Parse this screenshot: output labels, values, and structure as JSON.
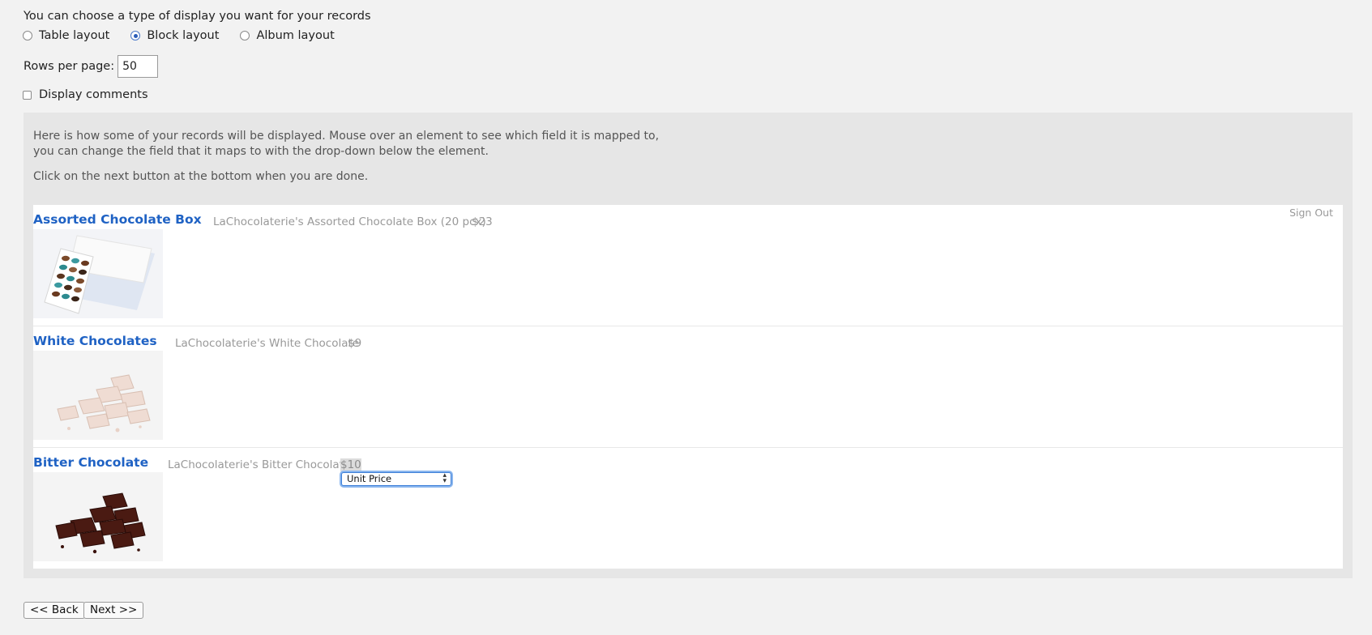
{
  "intro_text": "You can choose a type of display you want for your records",
  "layout_options": [
    {
      "label": "Table layout",
      "checked": false
    },
    {
      "label": "Block layout",
      "checked": true
    },
    {
      "label": "Album layout",
      "checked": false
    }
  ],
  "rows_per_page": {
    "label": "Rows per page:",
    "value": "50"
  },
  "display_comments": {
    "label": "Display comments",
    "checked": false
  },
  "help": {
    "line1": "Here is how some of your records will be displayed. Mouse over an element to see which field it is mapped to, you can change the field that it maps to with the drop-down below the element.",
    "line2": "Click on the next button at the bottom when you are done."
  },
  "sign_out": "Sign Out",
  "records": [
    {
      "title": "Assorted Chocolate Box",
      "description": "LaChocolaterie's Assorted Chocolate Box (20 pcx)",
      "price": "$23",
      "image": "chocolate-box-image"
    },
    {
      "title": "White Chocolates",
      "description": "LaChocolaterie's White Chocolate",
      "price": "$9",
      "image": "white-chocolate-image"
    },
    {
      "title": "Bitter Chocolate",
      "description": "LaChocolaterie's Bitter Chocolate",
      "price": "$10",
      "image": "dark-chocolate-image"
    }
  ],
  "field_select": {
    "selected": "Unit Price"
  },
  "buttons": {
    "back": "<< Back",
    "next": "Next >>"
  },
  "colors": {
    "link_blue": "#1f62c4",
    "panel_gray": "#e6e6e6",
    "page_bg": "#f2f2f2"
  }
}
